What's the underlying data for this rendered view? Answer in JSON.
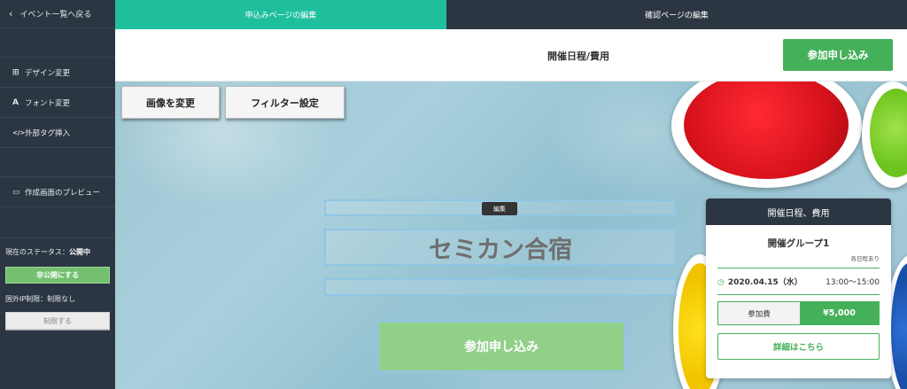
{
  "sidebar": {
    "back_label": "イベント一覧へ戻る",
    "items": [
      {
        "icon": "layout-icon",
        "glyph": "⊞",
        "label": "デザイン変更"
      },
      {
        "icon": "font-icon",
        "glyph": "A",
        "label": "フォント変更"
      },
      {
        "icon": "code-icon",
        "glyph": "</>",
        "label": "外部タグ挿入"
      },
      {
        "icon": "monitor-icon",
        "glyph": "▭",
        "label": "作成画面のプレビュー"
      }
    ],
    "status_label": "現在のステータス：",
    "status_value": "公開中",
    "unpublish_button": "非公開にする",
    "ip_restriction": "国外IP制限：制限なし",
    "restrict_button": "制限する"
  },
  "tabs": [
    {
      "label": "申込みページの編集",
      "active": true
    },
    {
      "label": "確認ページの編集",
      "active": false
    }
  ],
  "header": {
    "title": "開催日程/費用",
    "apply_button": "参加申し込み"
  },
  "hero": {
    "change_image_button": "画像を変更",
    "filter_button": "フィルター設定",
    "edit_badge": "編集",
    "title": "セミカン合宿",
    "apply_button": "参加申し込み"
  },
  "card": {
    "header": "開催日程、費用",
    "group_name": "開催グループ1",
    "note": "各日程あり",
    "date": "2020.04.15（水）",
    "time": "13:00〜15:00",
    "fee_label": "参加費",
    "fee_value": "¥5,000",
    "detail_button": "詳細はこちら"
  },
  "colors": {
    "accent_green": "#45b05a",
    "tab_teal": "#1fbf9e",
    "sidebar_dark": "#2b3642"
  }
}
